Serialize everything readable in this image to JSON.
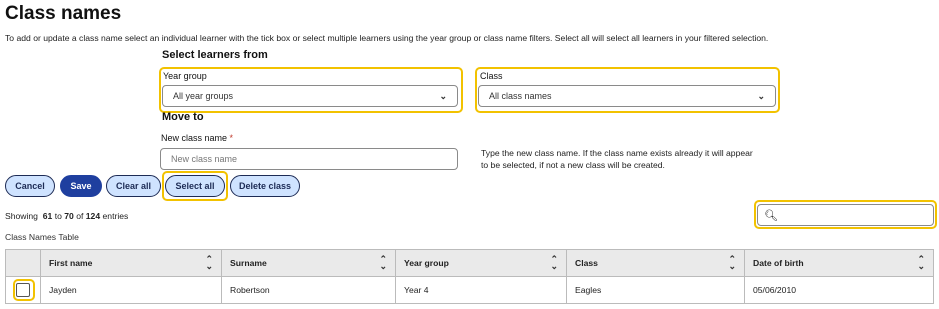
{
  "page": {
    "title": "Class names",
    "intro": "To add or update a class name select an individual learner with the tick box or select multiple learners using the year group or class name filters. Select all will select all learners in your filtered selection."
  },
  "filters": {
    "heading": "Select learners from",
    "year_group_label": "Year group",
    "year_group_value": "All year groups",
    "class_label": "Class",
    "class_value": "All class names"
  },
  "move_to": {
    "heading": "Move to",
    "new_class_label": "New class name",
    "required_mark": "*",
    "placeholder": "New class name",
    "help_line1": "Type the new class name. If the class name exists already it will appear",
    "help_line2": "to be selected, if not a new class will be created."
  },
  "buttons": {
    "cancel": "Cancel",
    "save": "Save",
    "clear_all": "Clear all",
    "select_all": "Select all",
    "delete_class": "Delete class"
  },
  "pagination": {
    "prefix": "Showing",
    "from": "61",
    "to_word": "to",
    "to": "70",
    "of_word": "of",
    "total": "124",
    "suffix": "entries"
  },
  "table": {
    "caption": "Class Names Table",
    "columns": [
      "First name",
      "Surname",
      "Year group",
      "Class",
      "Date of birth"
    ],
    "rows": [
      {
        "first_name": "Jayden",
        "surname": "Robertson",
        "year_group": "Year 4",
        "class": "Eagles",
        "dob": "05/06/2010"
      }
    ]
  },
  "icons": {
    "search": "search-icon",
    "sort": "sort-icon",
    "dropdown": "chevron-down-icon"
  },
  "colors": {
    "highlight": "#f2c200",
    "primary_button": "#1f3f9f",
    "secondary_button": "#cfe3ff",
    "button_border": "#1d2b55"
  }
}
